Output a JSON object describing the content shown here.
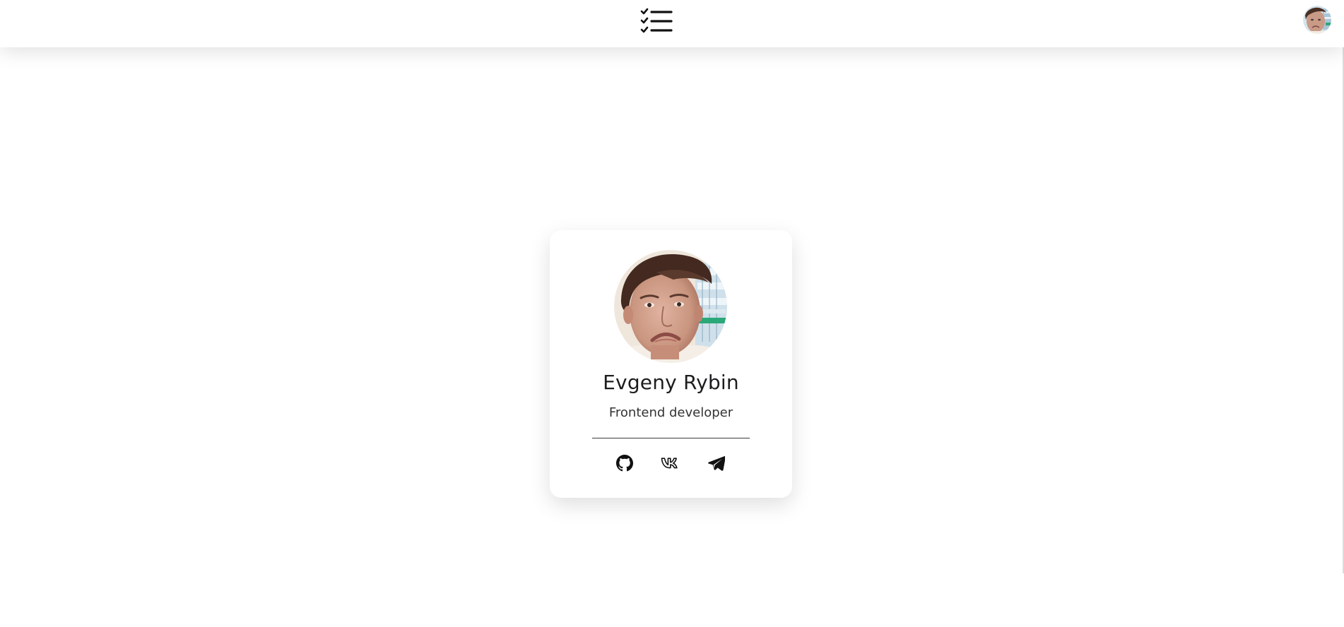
{
  "navbar": {
    "logo_icon": "checklist-icon",
    "avatar_icon": "user-avatar"
  },
  "profile": {
    "name": "Evgeny Rybin",
    "role": "Frontend developer",
    "photo_icon": "profile-photo"
  },
  "social_links": [
    {
      "icon": "github-icon"
    },
    {
      "icon": "vk-icon"
    },
    {
      "icon": "telegram-icon"
    }
  ],
  "colors": {
    "background": "#ffffff",
    "text": "#1d1d1f",
    "accent": "#000000"
  }
}
